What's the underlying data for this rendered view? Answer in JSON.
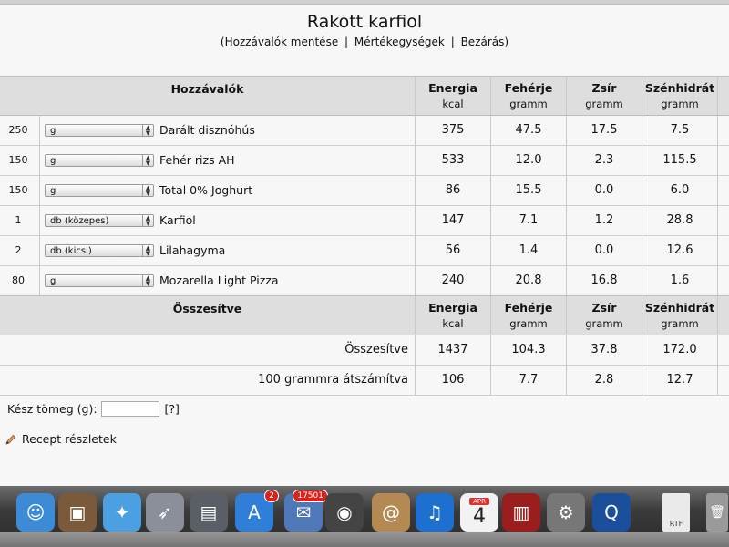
{
  "page": {
    "title": "Rakott karfiol",
    "links": [
      "(Hozzávalók mentése",
      "Mértékegységek",
      "Bezárás)"
    ]
  },
  "ingredients_header": {
    "col_ingredients": "Hozzávalók",
    "nutrients": [
      {
        "name": "Energia",
        "unit": "kcal"
      },
      {
        "name": "Fehérje",
        "unit": "gramm"
      },
      {
        "name": "Zsír",
        "unit": "gramm"
      },
      {
        "name": "Szénhidrát",
        "unit": "gramm"
      }
    ]
  },
  "ingredients": [
    {
      "qty": "250",
      "unit": "g",
      "name": "Darált disznóhús",
      "energy": "375",
      "protein": "47.5",
      "fat": "17.5",
      "carbs": "7.5"
    },
    {
      "qty": "150",
      "unit": "g",
      "name": "Fehér rizs AH",
      "energy": "533",
      "protein": "12.0",
      "fat": "2.3",
      "carbs": "115.5"
    },
    {
      "qty": "150",
      "unit": "g",
      "name": "Total 0% Joghurt",
      "energy": "86",
      "protein": "15.5",
      "fat": "0.0",
      "carbs": "6.0"
    },
    {
      "qty": "1",
      "unit": "db (közepes)",
      "name": "Karfiol",
      "energy": "147",
      "protein": "7.1",
      "fat": "1.2",
      "carbs": "28.8"
    },
    {
      "qty": "2",
      "unit": "db (kicsi)",
      "name": "Lilahagyma",
      "energy": "56",
      "protein": "1.4",
      "fat": "0.0",
      "carbs": "12.6"
    },
    {
      "qty": "80",
      "unit": "g",
      "name": "Mozarella Light Pizza",
      "energy": "240",
      "protein": "20.8",
      "fat": "16.8",
      "carbs": "1.6"
    }
  ],
  "summary_header": {
    "label": "Összesítve",
    "nutrients": [
      {
        "name": "Energia",
        "unit": "kcal"
      },
      {
        "name": "Fehérje",
        "unit": "gramm"
      },
      {
        "name": "Zsír",
        "unit": "gramm"
      },
      {
        "name": "Szénhidrát",
        "unit": "gramm"
      }
    ]
  },
  "summary_rows": [
    {
      "label": "Összesítve",
      "energy": "1437",
      "protein": "104.3",
      "fat": "37.8",
      "carbs": "172.0"
    },
    {
      "label": "100 grammra átszámítva",
      "energy": "106",
      "protein": "7.7",
      "fat": "2.8",
      "carbs": "12.7"
    }
  ],
  "weight": {
    "label": "Kész tömeg (g):",
    "value": "",
    "help": "[?]"
  },
  "recipe_details": {
    "label": "Recept részletek",
    "icon": "pencil-icon"
  },
  "dock": {
    "apps": [
      {
        "name": "finder-icon",
        "color": "#3d8bd6",
        "glyph": "☺"
      },
      {
        "name": "iphoto-icon",
        "color": "#7a5a3a",
        "glyph": "▣"
      },
      {
        "name": "safari-icon",
        "color": "#4aa0e0",
        "glyph": "✦"
      },
      {
        "name": "launchpad-icon",
        "color": "#8a8f99",
        "glyph": "➶"
      },
      {
        "name": "mission-control-icon",
        "color": "#5a5e66",
        "glyph": "▤"
      },
      {
        "name": "app-store-icon",
        "color": "#2f7fd8",
        "glyph": "A",
        "badge": "2"
      },
      {
        "name": "mail-icon",
        "color": "#4e78b8",
        "glyph": "✉",
        "badge": "17501"
      },
      {
        "name": "facetime-icon",
        "color": "#444",
        "glyph": "◉"
      },
      {
        "name": "contacts-icon",
        "color": "#b48a52",
        "glyph": "@"
      },
      {
        "name": "itunes-icon",
        "color": "#1d6fd0",
        "glyph": "♫"
      },
      {
        "name": "calendar-icon",
        "color": "#f2f2f2",
        "glyph": "4",
        "month": "APR"
      },
      {
        "name": "photo-booth-icon",
        "color": "#9a1e1e",
        "glyph": "▥"
      },
      {
        "name": "system-preferences-icon",
        "color": "#777",
        "glyph": "⚙"
      },
      {
        "name": "quicktime-icon",
        "color": "#1b4f9c",
        "glyph": "Q"
      },
      {
        "name": "rtf-document-icon",
        "color": "#eaeaea",
        "glyph": "RTF"
      },
      {
        "name": "trash-icon",
        "color": "#9a9a9a",
        "glyph": "🗑"
      }
    ]
  }
}
